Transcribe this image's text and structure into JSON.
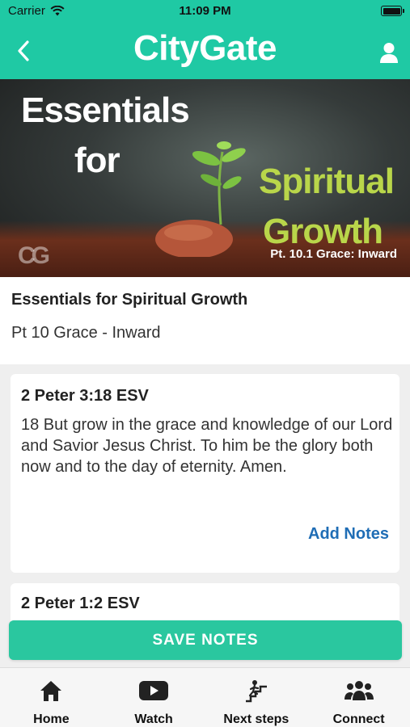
{
  "status": {
    "carrier": "Carrier",
    "time": "11:09 PM",
    "battery_level": 1.0
  },
  "nav": {
    "title": "CityGate"
  },
  "hero": {
    "line1": "Essentials",
    "line2": "for",
    "line3": "Spiritual",
    "line4": "Growth",
    "caption": "Pt. 10.1 Grace: Inward",
    "watermark": "CG"
  },
  "intro": {
    "title": "Essentials for Spiritual Growth",
    "subtitle": "Pt 10 Grace - Inward"
  },
  "cards": [
    {
      "reference": "2 Peter 3:18 ESV",
      "verse": "18 But grow in the grace and knowledge of our Lord and Savior Jesus Christ. To him be the glory both now and to the day of eternity. Amen.",
      "action": "Add Notes"
    },
    {
      "reference": "2 Peter 1:2 ESV"
    }
  ],
  "save_button": "SAVE NOTES",
  "tabs": [
    {
      "label": "Home",
      "icon": "home-icon"
    },
    {
      "label": "Watch",
      "icon": "play-icon"
    },
    {
      "label": "Next steps",
      "icon": "stairs-icon"
    },
    {
      "label": "Connect",
      "icon": "group-icon"
    }
  ],
  "colors": {
    "brand": "#1fc9a4",
    "link": "#1f6db5",
    "button": "#2ac79f"
  }
}
